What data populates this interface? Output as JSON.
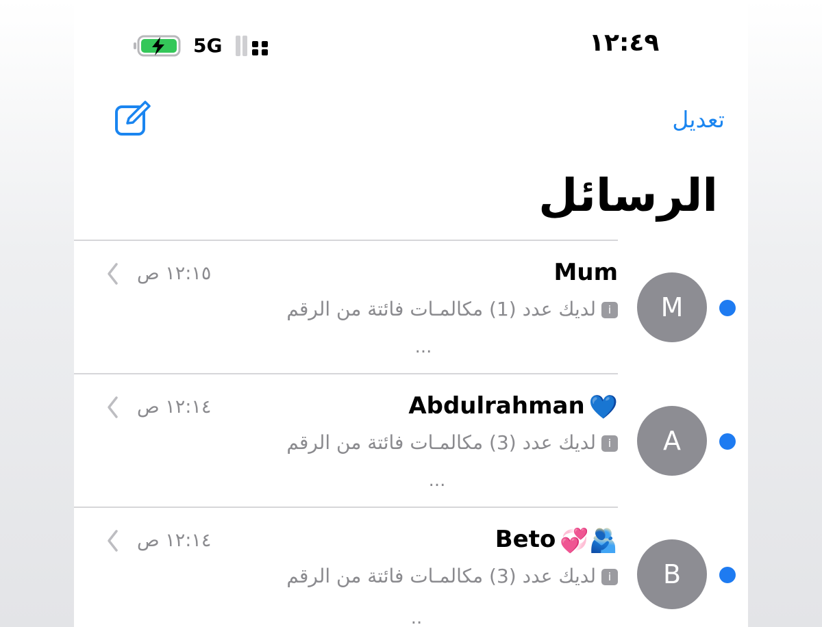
{
  "status_bar": {
    "time": "١٢:٤٩",
    "network": "5G",
    "battery_icon": "battery-charging-icon",
    "signal_icon": "signal-bars-icon"
  },
  "header": {
    "edit_label": "تعديل",
    "compose_icon": "compose-icon",
    "title": "الرسائل"
  },
  "accent_color": "#1a85f0",
  "conversations": [
    {
      "avatar_initial": "M",
      "name": "Mum",
      "name_emoji": "",
      "time": "١٢:١٥ ص",
      "preview": "لديك عدد (1) مكالمـات فائتة من الرقم",
      "preview_more": "...",
      "unread": true
    },
    {
      "avatar_initial": "A",
      "name": "Abdulrahman",
      "name_emoji": "💙",
      "time": "١٢:١٤ ص",
      "preview": "لديك عدد (3) مكالمـات فائتة من الرقم",
      "preview_more": "...",
      "unread": true
    },
    {
      "avatar_initial": "B",
      "name": "Beto",
      "name_emoji": "💞🫂",
      "time": "١٢:١٤ ص",
      "preview": "لديك عدد (3) مكالمـات فائتة من الرقم",
      "preview_more": "..",
      "unread": true
    }
  ]
}
